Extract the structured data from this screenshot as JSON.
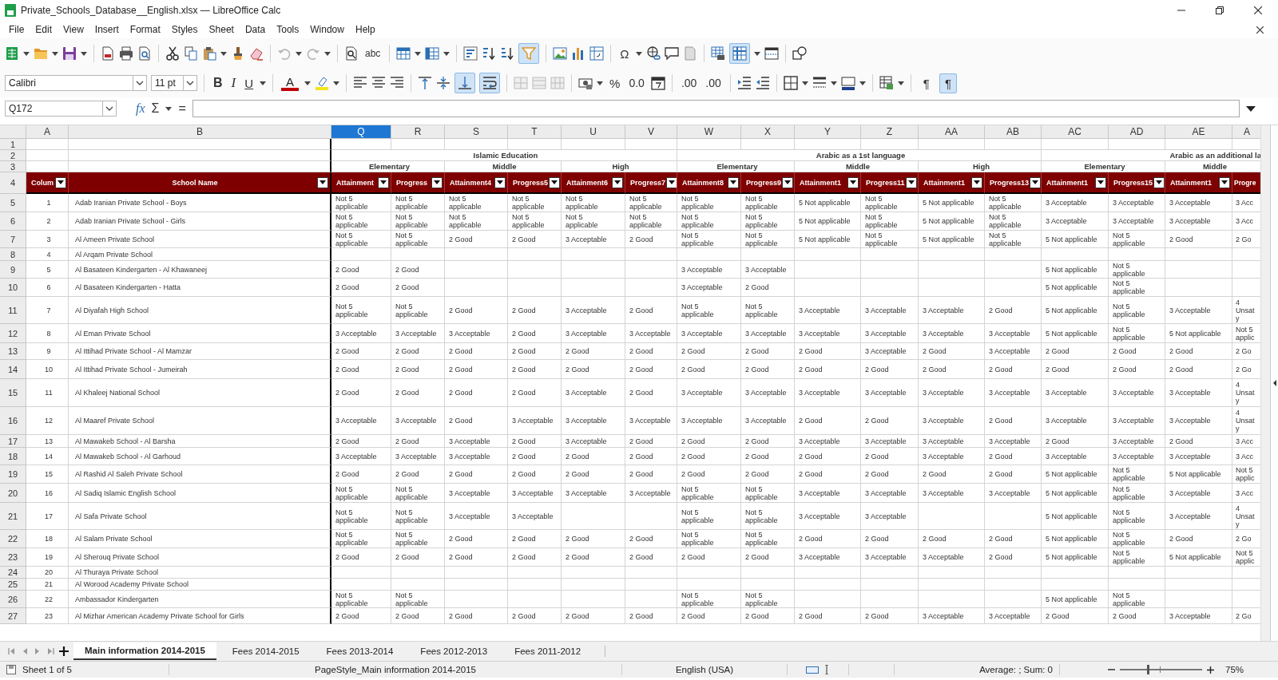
{
  "window": {
    "title": "Private_Schools_Database__English.xlsx — LibreOffice Calc"
  },
  "menu": [
    "File",
    "Edit",
    "View",
    "Insert",
    "Format",
    "Styles",
    "Sheet",
    "Data",
    "Tools",
    "Window",
    "Help"
  ],
  "standard_toolbar": {
    "spelling": "abc",
    "special_character": "Ω",
    "undo": {
      "disabled": true
    },
    "redo": {
      "disabled": true
    },
    "autofilter": {
      "on": true
    },
    "freeze": {
      "on": true
    }
  },
  "formatting_toolbar": {
    "font_name": "Calibri",
    "font_size": "11 pt",
    "bold": "B",
    "italic": "I",
    "underline": "U",
    "font_color": "A",
    "percent": "%",
    "number_format": "0.0",
    "add_decimal": ".00",
    "delete_decimal": ".00",
    "align_bottom": {
      "on": true
    },
    "wrap_text": {
      "on": true
    },
    "left_to_right": {
      "glyph": "¶",
      "on": false
    },
    "right_to_left": {
      "glyph": "¶",
      "on": true
    }
  },
  "formula_bar": {
    "name_box": "Q172",
    "function_wizard": "fx",
    "sum": "Σ",
    "formula": "="
  },
  "grid": {
    "columns": [
      {
        "label": "A",
        "selected": false
      },
      {
        "label": "B",
        "selected": false
      },
      {
        "label": "Q",
        "selected": true
      },
      {
        "label": "R",
        "selected": false
      },
      {
        "label": "S",
        "selected": false
      },
      {
        "label": "T",
        "selected": false
      },
      {
        "label": "U",
        "selected": false
      },
      {
        "label": "V",
        "selected": false
      },
      {
        "label": "W",
        "selected": false
      },
      {
        "label": "X",
        "selected": false
      },
      {
        "label": "Y",
        "selected": false
      },
      {
        "label": "Z",
        "selected": false
      },
      {
        "label": "AA",
        "selected": false
      },
      {
        "label": "AB",
        "selected": false
      },
      {
        "label": "AC",
        "selected": false
      },
      {
        "label": "AD",
        "selected": false
      },
      {
        "label": "AE",
        "selected": false
      },
      {
        "label": "A",
        "selected": false
      }
    ],
    "top_row_numbers": [
      "1",
      "2",
      "3",
      "4"
    ],
    "groups": [
      "Islamic Education",
      "Arabic as a 1st language",
      "Arabic as an additional la"
    ],
    "subgroups": [
      "Elementary",
      "Middle",
      "High",
      "Elementary",
      "Middle",
      "High",
      "Elementary",
      "Middle"
    ],
    "headers": [
      {
        "text": "Colum",
        "filter": true
      },
      {
        "text": "School Name",
        "filter": true
      },
      {
        "text": "Attainment",
        "filter": true
      },
      {
        "text": "Progress",
        "filter": true
      },
      {
        "text": "Attainment4",
        "filter": true
      },
      {
        "text": "Progress5",
        "filter": true
      },
      {
        "text": "Attainment6",
        "filter": true
      },
      {
        "text": "Progress7",
        "filter": true
      },
      {
        "text": "Attainment8",
        "filter": true
      },
      {
        "text": "Progress9",
        "filter": true
      },
      {
        "text": "Attainment1",
        "filter": true
      },
      {
        "text": "Progress11",
        "filter": true
      },
      {
        "text": "Attainment1",
        "filter": true
      },
      {
        "text": "Progress13",
        "filter": true
      },
      {
        "text": "Attainment1",
        "filter": true
      },
      {
        "text": "Progress15",
        "filter": true
      },
      {
        "text": "Attainment1",
        "filter": true
      },
      {
        "text": "Progre",
        "filter": false
      }
    ],
    "rows": [
      {
        "number": "5",
        "id": "1",
        "school": "Adab Iranian Private School - Boys",
        "cells": [
          "Not 5\napplicable",
          "Not 5\napplicable",
          "Not 5\napplicable",
          "Not 5\napplicable",
          "Not 5\napplicable",
          "Not 5\napplicable",
          "Not 5\napplicable",
          "Not 5\napplicable",
          "5 Not applicable",
          "Not 5\napplicable",
          "5 Not applicable",
          "Not 5\napplicable",
          "3 Acceptable",
          "3 Acceptable",
          "3 Acceptable",
          "3 Acc"
        ]
      },
      {
        "number": "6",
        "id": "2",
        "school": "Adab Iranian Private School - Girls",
        "cells": [
          "Not 5\napplicable",
          "Not 5\napplicable",
          "Not 5\napplicable",
          "Not 5\napplicable",
          "Not 5\napplicable",
          "Not 5\napplicable",
          "Not 5\napplicable",
          "Not 5\napplicable",
          "5 Not applicable",
          "Not 5\napplicable",
          "5 Not applicable",
          "Not 5\napplicable",
          "3 Acceptable",
          "3 Acceptable",
          "3 Acceptable",
          "3 Acc"
        ]
      },
      {
        "number": "7",
        "id": "3",
        "school": "Al Ameen Private School",
        "cells": [
          "Not 5\napplicable",
          "Not 5\napplicable",
          "2 Good",
          "2 Good",
          "3 Acceptable",
          "2 Good",
          "Not 5\napplicable",
          "Not 5\napplicable",
          "5 Not applicable",
          "Not 5\napplicable",
          "5 Not applicable",
          "Not 5\napplicable",
          "5 Not applicable",
          "Not 5\napplicable",
          "2 Good",
          "2 Go"
        ]
      },
      {
        "number": "8",
        "id": "4",
        "school": "Al Arqam Private School"
      },
      {
        "number": "9",
        "id": "5",
        "school": "Al Basateen Kindergarten - Al Khawaneej",
        "cells": [
          "2 Good",
          "2 Good",
          null,
          null,
          null,
          null,
          "3 Acceptable",
          "3 Acceptable",
          null,
          null,
          null,
          null,
          "5 Not applicable",
          "Not 5\napplicable",
          null,
          null
        ]
      },
      {
        "number": "10",
        "id": "6",
        "school": "Al Basateen Kindergarten - Hatta",
        "cells": [
          "2 Good",
          "2 Good",
          null,
          null,
          null,
          null,
          "3 Acceptable",
          "2 Good",
          null,
          null,
          null,
          null,
          "5 Not applicable",
          "Not 5\napplicable",
          null,
          null
        ]
      },
      {
        "number": "11",
        "id": "7",
        "school": "Al Diyafah High School",
        "cells": [
          "Not 5\napplicable",
          "Not 5\napplicable",
          "2 Good",
          "2 Good",
          "3 Acceptable",
          "2 Good",
          "Not 5\napplicable",
          "Not 5\napplicable",
          "3 Acceptable",
          "3 Acceptable",
          "3 Acceptable",
          "2 Good",
          "5 Not applicable",
          "Not 5\napplicable",
          "3 Acceptable",
          "4\nUnsat\ny"
        ]
      },
      {
        "number": "12",
        "id": "8",
        "school": "Al Eman Private School",
        "cells": [
          "3 Acceptable",
          "3 Acceptable",
          "3 Acceptable",
          "2 Good",
          "3 Acceptable",
          "3 Acceptable",
          "3 Acceptable",
          "3 Acceptable",
          "3 Acceptable",
          "3 Acceptable",
          "3 Acceptable",
          "3 Acceptable",
          "5 Not applicable",
          "Not 5\napplicable",
          "5 Not applicable",
          "Not 5\napplic"
        ]
      },
      {
        "number": "13",
        "id": "9",
        "school": "Al Ittihad Private School - Al Mamzar",
        "cells": [
          "2 Good",
          "2 Good",
          "2 Good",
          "2 Good",
          "2 Good",
          "2 Good",
          "2 Good",
          "2 Good",
          "2 Good",
          "3 Acceptable",
          "2 Good",
          "3 Acceptable",
          "2 Good",
          "2 Good",
          "2 Good",
          "2 Go"
        ]
      },
      {
        "number": "14",
        "id": "10",
        "school": "Al Ittihad Private School - Jumeirah",
        "cells": [
          "2 Good",
          "2 Good",
          "2 Good",
          "2 Good",
          "2 Good",
          "2 Good",
          "2 Good",
          "2 Good",
          "2 Good",
          "2 Good",
          "2 Good",
          "2 Good",
          "2 Good",
          "2 Good",
          "2 Good",
          "2 Go"
        ]
      },
      {
        "number": "15",
        "id": "11",
        "school": "Al Khaleej National School",
        "cells": [
          "2 Good",
          "2 Good",
          "2 Good",
          "2 Good",
          "3 Acceptable",
          "2 Good",
          "3 Acceptable",
          "3 Acceptable",
          "3 Acceptable",
          "3 Acceptable",
          "3 Acceptable",
          "3 Acceptable",
          "3 Acceptable",
          "3 Acceptable",
          "3 Acceptable",
          "4\nUnsat\ny"
        ]
      },
      {
        "number": "16",
        "id": "12",
        "school": "Al Maaref Private School",
        "cells": [
          "3 Acceptable",
          "3 Acceptable",
          "2 Good",
          "3 Acceptable",
          "3 Acceptable",
          "3 Acceptable",
          "3 Acceptable",
          "3 Acceptable",
          "2 Good",
          "2 Good",
          "3 Acceptable",
          "2 Good",
          "3 Acceptable",
          "3 Acceptable",
          "3 Acceptable",
          "4\nUnsat\ny"
        ]
      },
      {
        "number": "17",
        "id": "13",
        "school": "Al Mawakeb School - Al Barsha",
        "cells": [
          "2 Good",
          "2 Good",
          "3 Acceptable",
          "2 Good",
          "3 Acceptable",
          "2 Good",
          "2 Good",
          "2 Good",
          "3 Acceptable",
          "3 Acceptable",
          "3 Acceptable",
          "3 Acceptable",
          "2 Good",
          "3 Acceptable",
          "2 Good",
          "3 Acc"
        ]
      },
      {
        "number": "18",
        "id": "14",
        "school": "Al Mawakeb School - Al Garhoud",
        "cells": [
          "3 Acceptable",
          "3 Acceptable",
          "3 Acceptable",
          "2 Good",
          "2 Good",
          "2 Good",
          "2 Good",
          "2 Good",
          "2 Good",
          "2 Good",
          "3 Acceptable",
          "2 Good",
          "3 Acceptable",
          "3 Acceptable",
          "3 Acceptable",
          "3 Acc"
        ]
      },
      {
        "number": "19",
        "id": "15",
        "school": "Al Rashid Al Saleh Private School",
        "cells": [
          "2 Good",
          "2 Good",
          "2 Good",
          "2 Good",
          "2 Good",
          "2 Good",
          "2 Good",
          "2 Good",
          "2 Good",
          "2 Good",
          "2 Good",
          "2 Good",
          "5 Not applicable",
          "Not 5\napplicable",
          "5 Not applicable",
          "Not 5\napplic"
        ]
      },
      {
        "number": "20",
        "id": "16",
        "school": "Al Sadiq Islamic English School",
        "cells": [
          "Not 5\napplicable",
          "Not 5\napplicable",
          "3 Acceptable",
          "3 Acceptable",
          "3 Acceptable",
          "3 Acceptable",
          "Not 5\napplicable",
          "Not 5\napplicable",
          "3 Acceptable",
          "3 Acceptable",
          "3 Acceptable",
          "3 Acceptable",
          "5 Not applicable",
          "Not 5\napplicable",
          "3 Acceptable",
          "3 Acc"
        ]
      },
      {
        "number": "21",
        "id": "17",
        "school": "Al Safa Private School",
        "cells": [
          "Not 5\napplicable",
          "Not 5\napplicable",
          "3 Acceptable",
          "3 Acceptable",
          null,
          null,
          "Not 5\napplicable",
          "Not 5\napplicable",
          "3 Acceptable",
          "3 Acceptable",
          null,
          null,
          "5 Not applicable",
          "Not 5\napplicable",
          "3 Acceptable",
          "4\nUnsat\ny"
        ]
      },
      {
        "number": "22",
        "id": "18",
        "school": "Al Salam Private School",
        "cells": [
          "Not 5\napplicable",
          "Not 5\napplicable",
          "2 Good",
          "2 Good",
          "2 Good",
          "2 Good",
          "Not 5\napplicable",
          "Not 5\napplicable",
          "2 Good",
          "2 Good",
          "2 Good",
          "2 Good",
          "5 Not applicable",
          "Not 5\napplicable",
          "2 Good",
          "2 Go"
        ]
      },
      {
        "number": "23",
        "id": "19",
        "school": "Al Sherouq Private School",
        "cells": [
          "2 Good",
          "2 Good",
          "2 Good",
          "2 Good",
          "2 Good",
          "2 Good",
          "2 Good",
          "2 Good",
          "3 Acceptable",
          "3 Acceptable",
          "3 Acceptable",
          "2 Good",
          "5 Not applicable",
          "Not 5\napplicable",
          "5 Not applicable",
          "Not 5\napplic"
        ]
      },
      {
        "number": "24",
        "id": "20",
        "school": "Al Thuraya Private School"
      },
      {
        "number": "25",
        "id": "21",
        "school": "Al Worood Academy Private School"
      },
      {
        "number": "26",
        "id": "22",
        "school": "Ambassador Kindergarten",
        "cells": [
          "Not 5\napplicable",
          "Not 5\napplicable",
          null,
          null,
          null,
          null,
          "Not 5\napplicable",
          "Not 5\napplicable",
          null,
          null,
          null,
          null,
          "5 Not applicable",
          "Not 5\napplicable",
          null,
          null
        ]
      },
      {
        "number": "27",
        "id": "23",
        "school": "Al Mizhar American Academy Private School for Girls",
        "cells": [
          "2 Good",
          "2 Good",
          "2 Good",
          "2 Good",
          "2 Good",
          "2 Good",
          "2 Good",
          "2 Good",
          "2 Good",
          "2 Good",
          "3 Acceptable",
          "3 Acceptable",
          "2 Good",
          "2 Good",
          "3 Acceptable",
          "2 Go"
        ]
      }
    ]
  },
  "sheet_tabs": [
    {
      "label": "Main information 2014-2015",
      "selected": true
    },
    {
      "label": "Fees 2014-2015",
      "selected": false
    },
    {
      "label": "Fees 2013-2014",
      "selected": false
    },
    {
      "label": "Fees 2012-2013",
      "selected": false
    },
    {
      "label": "Fees 2011-2012",
      "selected": false
    }
  ],
  "status_bar": {
    "sheet": "Sheet 1 of 5",
    "page_style": "PageStyle_Main information 2014-2015",
    "language": "English (USA)",
    "summary": "Average: ; Sum: 0",
    "zoom_slider": {
      "level": 0.34
    },
    "zoom": "75%"
  }
}
